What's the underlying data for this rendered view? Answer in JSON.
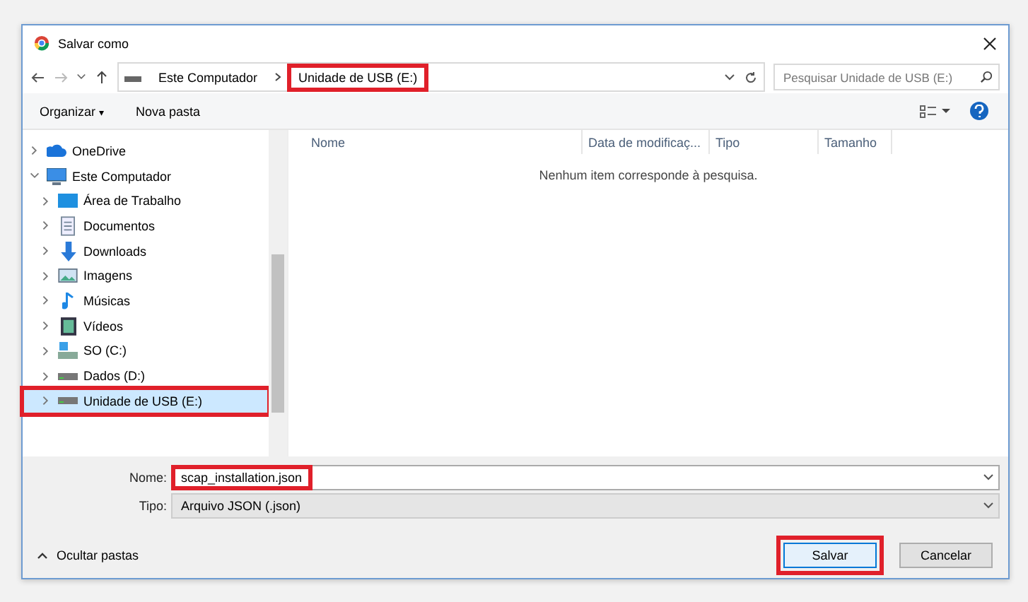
{
  "window": {
    "title": "Salvar como"
  },
  "address": {
    "segments": [
      {
        "label": "Este Computador",
        "highlighted": false
      },
      {
        "label": "Unidade de USB (E:)",
        "highlighted": true
      }
    ]
  },
  "search": {
    "placeholder": "Pesquisar Unidade de USB (E:)"
  },
  "toolbar": {
    "items": [
      {
        "label": "Organizar",
        "caret": "▾"
      },
      {
        "label": "Nova pasta"
      }
    ]
  },
  "sidebar": {
    "items": [
      {
        "label": "OneDrive",
        "kind": "cloud",
        "expanded": false,
        "selected": false,
        "highlighted": false
      },
      {
        "label": "Este Computador",
        "kind": "computer",
        "expanded": true,
        "selected": false,
        "highlighted": false,
        "children": [
          {
            "label": "Área de Trabalho",
            "kind": "desktop",
            "expanded": false,
            "selected": false,
            "highlighted": false
          },
          {
            "label": "Documentos",
            "kind": "documents",
            "expanded": false,
            "selected": false,
            "highlighted": false
          },
          {
            "label": "Downloads",
            "kind": "downloads",
            "expanded": false,
            "selected": false,
            "highlighted": false
          },
          {
            "label": "Imagens",
            "kind": "images",
            "expanded": false,
            "selected": false,
            "highlighted": false
          },
          {
            "label": "Músicas",
            "kind": "music",
            "expanded": false,
            "selected": false,
            "highlighted": false
          },
          {
            "label": "Vídeos",
            "kind": "videos",
            "expanded": false,
            "selected": false,
            "highlighted": false
          },
          {
            "label": "SO (C:)",
            "kind": "system-drive",
            "expanded": false,
            "selected": false,
            "highlighted": false
          },
          {
            "label": "Dados (D:)",
            "kind": "drive",
            "expanded": false,
            "selected": false,
            "highlighted": false
          },
          {
            "label": "Unidade de USB (E:)",
            "kind": "drive",
            "expanded": false,
            "selected": true,
            "highlighted": true
          }
        ]
      }
    ]
  },
  "table": {
    "columns": [
      "Nome",
      "Data de modificaç...",
      "Tipo",
      "Tamanho"
    ],
    "empty_message": "Nenhum item corresponde à pesquisa."
  },
  "fields": [
    {
      "label": "Nome:",
      "value": "scap_installation.json",
      "highlighted": true,
      "disabled": false
    },
    {
      "label": "Tipo:",
      "value": "Arquivo JSON (.json)",
      "highlighted": false,
      "disabled": true
    }
  ],
  "hide_folders": "Ocultar pastas",
  "buttons": [
    {
      "label": "Salvar",
      "kind": "primary",
      "highlighted": true
    },
    {
      "label": "Cancelar",
      "kind": "secondary",
      "highlighted": false
    }
  ]
}
